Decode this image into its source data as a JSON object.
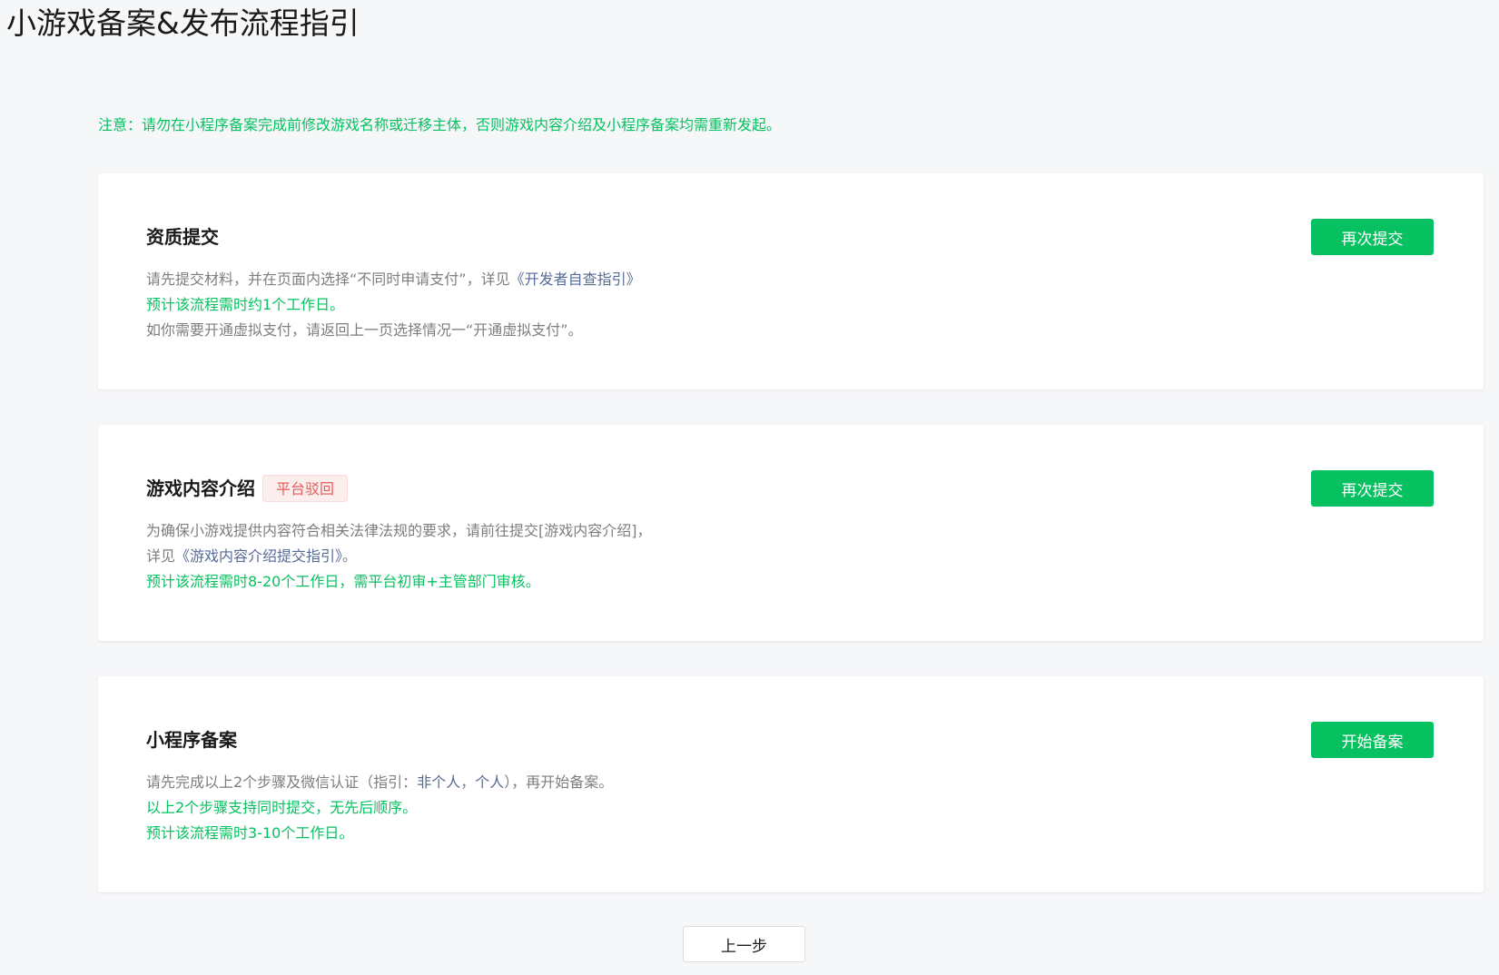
{
  "page": {
    "title": "小游戏备案&发布流程指引",
    "notice": "注意：请勿在小程序备案完成前修改游戏名称或迁移主体，否则游戏内容介绍及小程序备案均需重新发起。"
  },
  "cards": [
    {
      "title": "资质提交",
      "button_label": "再次提交",
      "line1_text": "请先提交材料，并在页面内选择“不同时申请支付”，详见",
      "line1_link": "《开发者自查指引》",
      "line2": "预计该流程需时约1个工作日。",
      "line3": "如你需要开通虚拟支付，请返回上一页选择情况一“开通虚拟支付”。"
    },
    {
      "title": "游戏内容介绍",
      "status_tag": "平台驳回",
      "button_label": "再次提交",
      "line1": "为确保小游戏提供内容符合相关法律法规的要求，请前往提交[游戏内容介绍]，",
      "line2_prefix": "详见",
      "line2_link": "《游戏内容介绍提交指引》",
      "line2_suffix": "。",
      "line3": "预计该流程需时8-20个工作日，需平台初审+主管部门审核。"
    },
    {
      "title": "小程序备案",
      "button_label": "开始备案",
      "line1_prefix": "请先完成以上2个步骤及微信认证（指引：",
      "line1_link1": "非个人",
      "line1_sep": "，",
      "line1_link2": "个人",
      "line1_suffix": "），再开始备案。",
      "line2": "以上2个步骤支持同时提交，无先后顺序。",
      "line3": "预计该流程需时3-10个工作日。"
    }
  ],
  "footer": {
    "prev_label": "上一步"
  },
  "colors": {
    "accent": "#07c160",
    "link": "#576b95",
    "muted_text": "#7e7e7e",
    "reject_tag_text": "#e65b5b",
    "reject_tag_bg": "#fdeeee",
    "background": "#f6f7f9"
  }
}
